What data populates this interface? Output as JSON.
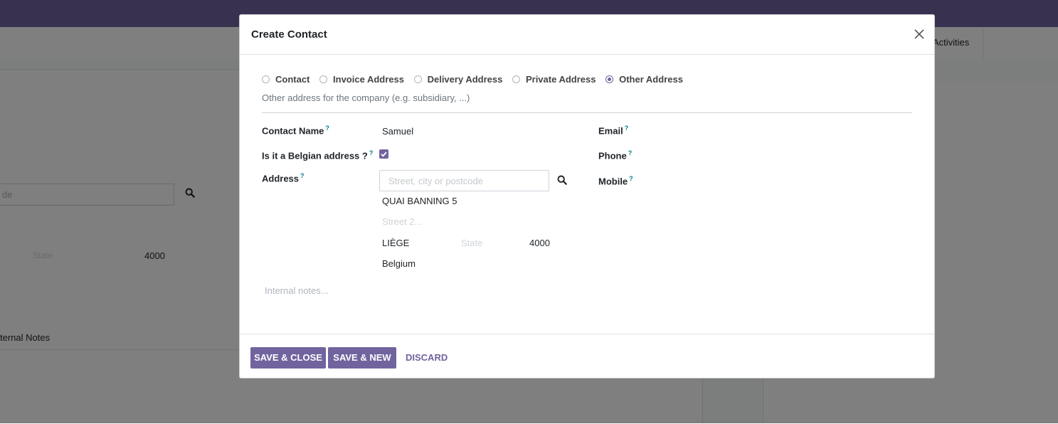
{
  "background": {
    "activities_label": "Activities",
    "search_placeholder_fragment": "de",
    "state_placeholder": "State",
    "zip_value": "4000",
    "notes_tab_label": "ternal Notes"
  },
  "modal": {
    "title": "Create Contact",
    "address_types": [
      {
        "label": "Contact",
        "checked": false
      },
      {
        "label": "Invoice Address",
        "checked": false
      },
      {
        "label": "Delivery Address",
        "checked": false
      },
      {
        "label": "Private Address",
        "checked": false
      },
      {
        "label": "Other Address",
        "checked": true
      }
    ],
    "type_description": "Other address for the company (e.g. subsidiary, ...)",
    "tooltip_mark": "?",
    "fields": {
      "contact_name_label": "Contact Name",
      "contact_name_value": "Samuel",
      "belgian_label": "Is it a Belgian address ?",
      "belgian_checked": true,
      "address_label": "Address",
      "address_search_placeholder": "Street, city or postcode",
      "street": "QUAI BANNING 5",
      "street2_placeholder": "Street 2...",
      "city": "LIÈGE",
      "state_placeholder": "State",
      "zip": "4000",
      "country": "Belgium",
      "email_label": "Email",
      "phone_label": "Phone",
      "mobile_label": "Mobile",
      "notes_placeholder": "Internal notes..."
    },
    "footer": {
      "save_close": "SAVE & CLOSE",
      "save_new": "SAVE & NEW",
      "discard": "DISCARD"
    }
  },
  "colors": {
    "brand": "#71639e",
    "tooltip": "#017e84"
  }
}
